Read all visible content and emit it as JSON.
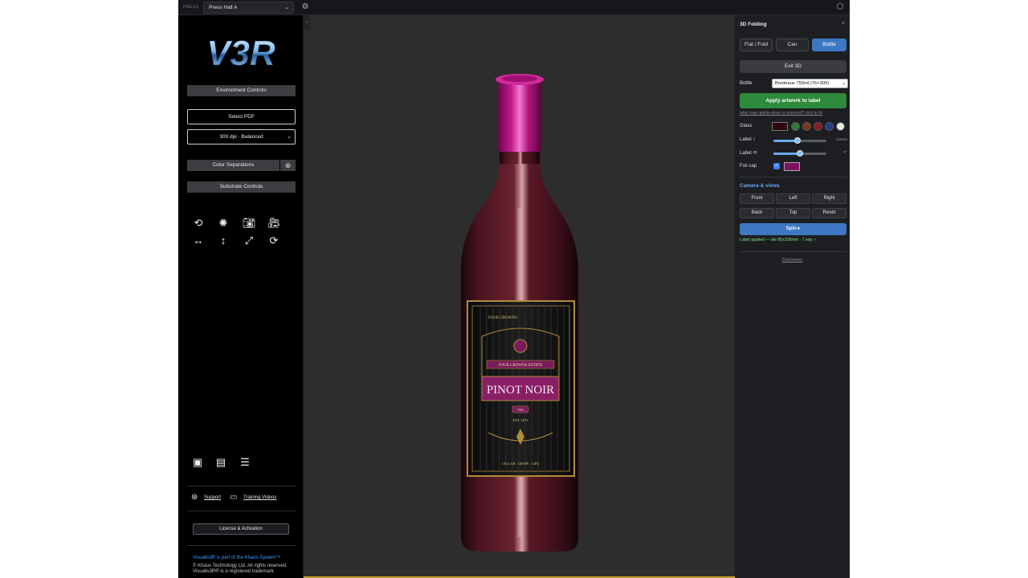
{
  "topbar": {
    "press_label": "PRESS",
    "press_value": "Press Hall A",
    "chevron": "⌄",
    "settings_icon": "gear-icon",
    "view_icon": "cube-icon"
  },
  "sidebar": {
    "logo_text": "V3R",
    "environment_controls": "Environment Controls",
    "select_pdf": "Select PDF",
    "dpi_value": "300 dpi · Balanced",
    "color_separations": "Color Separations",
    "substrate_controls": "Substrate Controls",
    "support": "Support",
    "training_videos": "Training Videos",
    "license": "License & Activation",
    "footer_line1": "Visualis3R is part of the Khaos System™",
    "footer_line2": "© Khaos Technology Ltd. All rights reserved. Visualis3R® is a registered trademark."
  },
  "viewport": {
    "label": {
      "top_left": "FOUR CROWNS",
      "estate": "FOUR CROWNS ESTATE",
      "title": "PINOT NOIR",
      "year": "1902",
      "est": "EST. 1873",
      "bottom": "CELLAR · GRAPE · LIFE"
    },
    "colors": {
      "background": "#2d2d2d",
      "bottle_glass": "#4a1420",
      "foil_cap": "#c0188c",
      "label_bg": "#111111",
      "label_gold": "#b08d3a",
      "label_banner": "#7a1a5a"
    }
  },
  "panel": {
    "title": "3D Folding",
    "close": "×",
    "modes": [
      "Flat / Fold",
      "Can",
      "Bottle"
    ],
    "active_mode": "Bottle",
    "exit_3d": "Exit 3D",
    "bottle_label": "Bottle",
    "bottle_value": "Bordeaux 750ml (76×300)",
    "apply": "Apply artwork to label",
    "hint": "label map upside-down or mirrored? click to fix",
    "glass_label": "Glass",
    "glass_swatches": [
      "#2f7a3b",
      "#7a3a1a",
      "#8a1a22",
      "#1e3e8a",
      "#e8e8e8"
    ],
    "label_v_label": "Label ↕",
    "label_v_value": "-12mm",
    "label_v_level": 0.45,
    "label_h_label": "Label ⟲",
    "label_h_value": "0°",
    "label_h_level": 0.5,
    "foil_label": "Foil cap",
    "foil_color": "#7a1260",
    "camera_heading": "Camera & views",
    "camera_buttons": [
      "Front",
      "Left",
      "Right",
      "Back",
      "Top",
      "Reset"
    ],
    "spin": "Spin ▸",
    "status": "Label applied — die 86x109mm · 7 sep ✓",
    "disclaimer": "Disclaimer"
  }
}
